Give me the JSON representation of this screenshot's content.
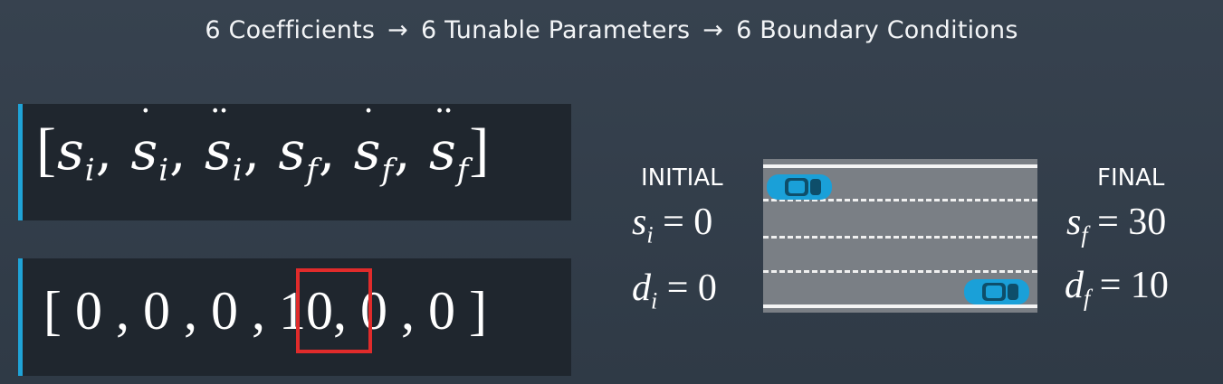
{
  "header": {
    "part1": "6 Coefficients",
    "arrow": "→",
    "part2": "6 Tunable Parameters",
    "part3": "6 Boundary Conditions"
  },
  "vector_symbols": {
    "open": "[",
    "s_i": "s",
    "sub_i": "i",
    "sub_f": "f",
    "comma": ",",
    "close": "]"
  },
  "vector_values": {
    "text_before": "[ 0 , 0 , 0 , ",
    "highlighted": "10",
    "text_after": ", 0 , 0 ]"
  },
  "initial": {
    "label": "INITIAL",
    "s_eq": "s",
    "s_sub": "i",
    "s_rhs": "= 0",
    "d_eq": "d",
    "d_sub": "i",
    "d_rhs": "= 0"
  },
  "final": {
    "label": "FINAL",
    "s_eq": "s",
    "s_sub": "f",
    "s_rhs": "= 30",
    "d_eq": "d",
    "d_sub": "f",
    "d_rhs": "= 10"
  },
  "colors": {
    "accent": "#1fa3d7",
    "highlight": "#e02b2b",
    "car": "#1aa0d8",
    "road": "#7a7f85"
  },
  "icons": [
    "car-icon-initial",
    "car-icon-final"
  ]
}
